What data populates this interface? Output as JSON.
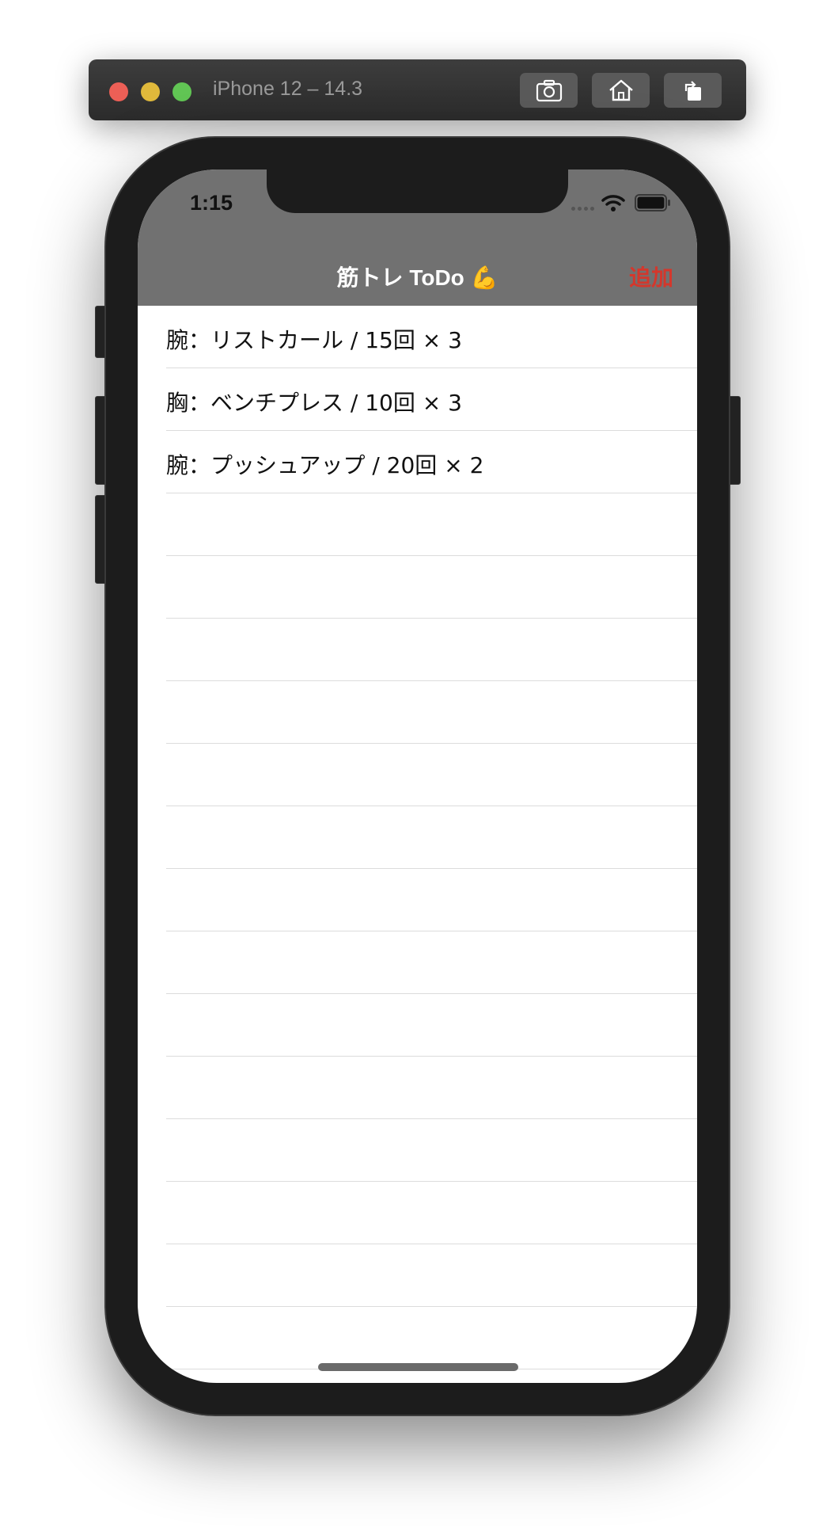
{
  "simulator": {
    "title": "iPhone 12 – 14.3",
    "buttons": [
      "screenshot-icon",
      "home-icon",
      "rotate-icon"
    ]
  },
  "status_bar": {
    "time": "1:15"
  },
  "nav": {
    "title": "筋トレ ToDo 💪",
    "add_label": "追加",
    "add_color": "#d4372c",
    "bar_color": "#717171"
  },
  "list": {
    "items": [
      "腕：リストカール / 15回 × 3",
      "胸：ベンチプレス / 10回 × 3",
      "腕：プッシュアップ / 20回 × 2"
    ]
  }
}
